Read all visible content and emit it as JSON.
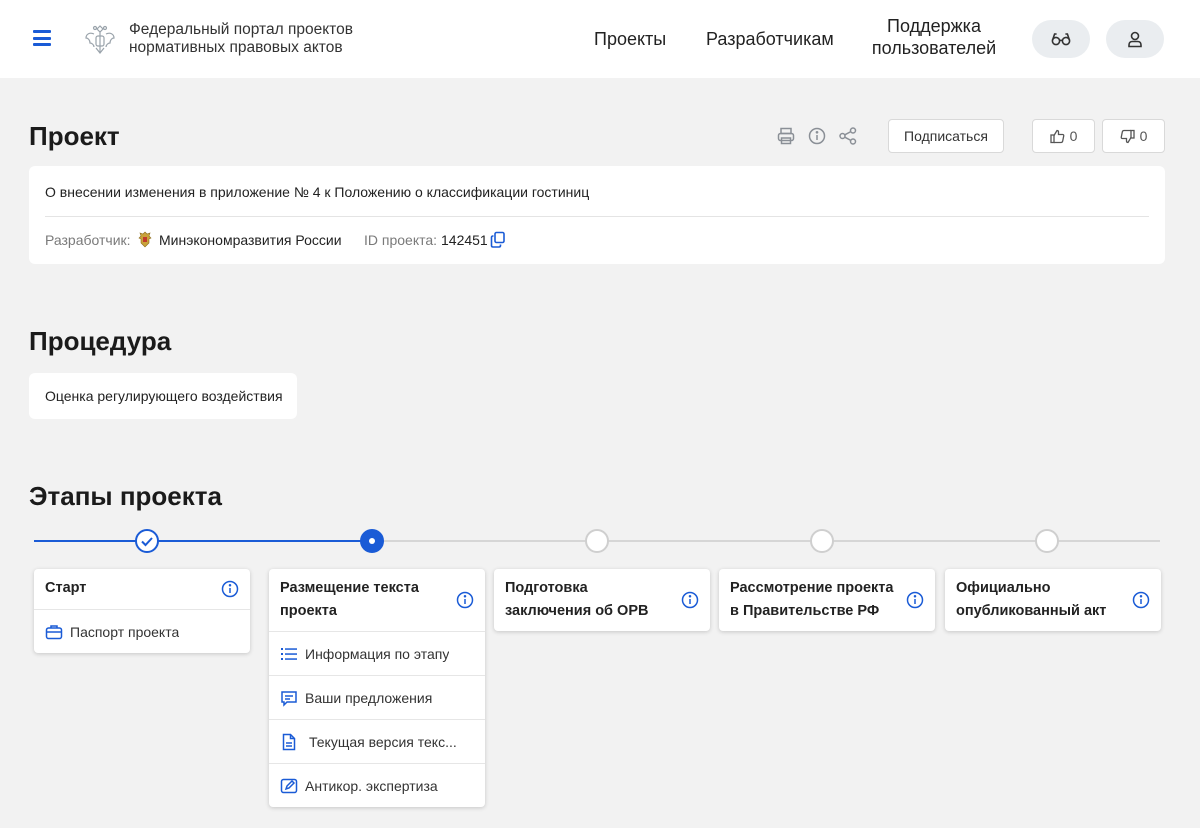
{
  "header": {
    "portal_title_line1": "Федеральный портал проектов",
    "portal_title_line2": "нормативных правовых актов",
    "nav": {
      "projects": "Проекты",
      "developers": "Разработчикам",
      "support_line1": "Поддержка",
      "support_line2": "пользователей"
    },
    "icons": [
      "menu-icon",
      "emblem-icon",
      "glasses-icon",
      "user-icon"
    ]
  },
  "project": {
    "section_title": "Проект",
    "subscribe_label": "Подписаться",
    "likes": "0",
    "dislikes": "0",
    "name": "О внесении изменения в приложение № 4 к Положению о классификации гостиниц",
    "developer_label": "Разработчик:",
    "developer_value": "Минэкономразвития России",
    "id_label": "ID проекта:",
    "id_value": "142451"
  },
  "procedure": {
    "section_title": "Процедура",
    "value": "Оценка регулирующего воздействия"
  },
  "stages": {
    "section_title": "Этапы проекта",
    "items": [
      {
        "title": "Старт",
        "status": "done",
        "rows": [
          {
            "label": "Паспорт проекта",
            "icon": "briefcase-icon"
          }
        ]
      },
      {
        "title": "Размещение текста проекта",
        "status": "current",
        "rows": [
          {
            "label": "Информация по этапу",
            "icon": "list-icon"
          },
          {
            "label": "Ваши предложения",
            "icon": "comment-icon"
          },
          {
            "label": "Текущая версия текс...",
            "icon": "document-icon"
          },
          {
            "label": "Антикор. экспертиза",
            "icon": "edit-icon"
          }
        ]
      },
      {
        "title": "Подготовка заключения об ОРВ",
        "status": "pending",
        "rows": []
      },
      {
        "title": "Рассмотрение проекта в Правительстве РФ",
        "status": "pending",
        "rows": []
      },
      {
        "title": "Официально опубликованный акт",
        "status": "pending",
        "rows": []
      }
    ]
  },
  "colors": {
    "accent": "#1a5bd6",
    "background": "#f2f2f2",
    "card": "#ffffff",
    "inactive": "#d6d6d6"
  }
}
